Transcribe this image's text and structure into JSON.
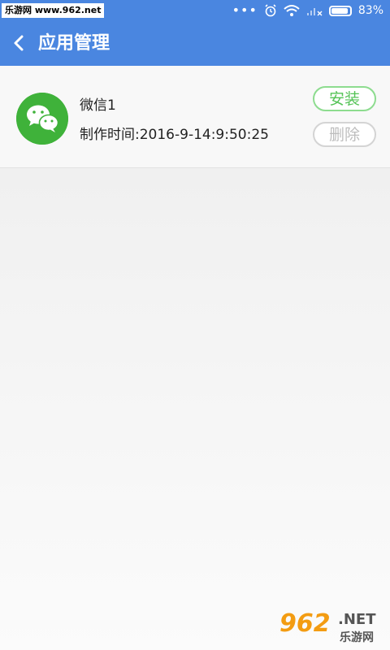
{
  "status_bar": {
    "watermark": "乐游网 www.962.net",
    "battery": "83%",
    "battery_level": 0.83
  },
  "header": {
    "title": "应用管理"
  },
  "apps": [
    {
      "name": "微信1",
      "time": "制作时间:2016-9-14:9:50:25",
      "install_label": "安装",
      "delete_label": "删除"
    }
  ],
  "watermark_bottom": {
    "number": "962",
    "net": ".NET",
    "site": "乐游网"
  },
  "colors": {
    "accent": "#4a86e0",
    "install": "#55c357",
    "delete": "#bdbdbd",
    "app_icon": "#3fb23a"
  }
}
